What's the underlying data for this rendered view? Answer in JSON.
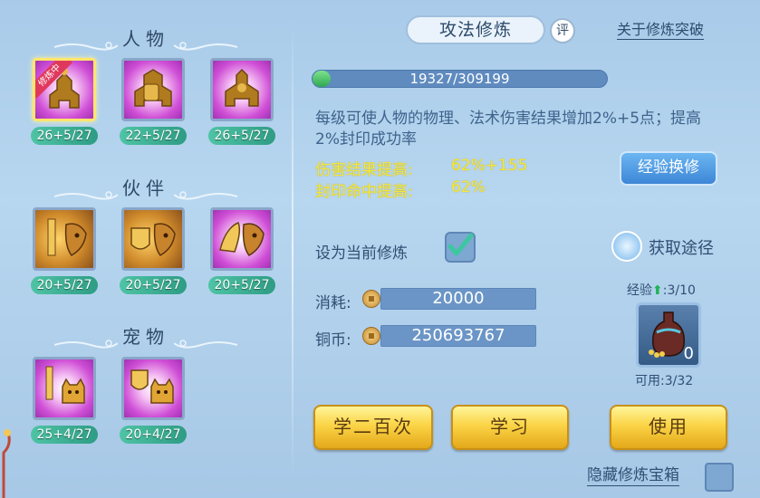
{
  "left": {
    "sections": [
      {
        "title": "人物",
        "skills": [
          {
            "level": "26+5/27",
            "icon": "character-attack-skill-icon",
            "badge": "修炼中",
            "selected": true
          },
          {
            "level": "22+5/27",
            "icon": "character-defense-skill-icon"
          },
          {
            "level": "26+5/27",
            "icon": "character-resist-skill-icon"
          }
        ]
      },
      {
        "title": "伙伴",
        "skills": [
          {
            "level": "20+5/27",
            "icon": "partner-attack-skill-icon"
          },
          {
            "level": "20+5/27",
            "icon": "partner-defense-skill-icon"
          },
          {
            "level": "20+5/27",
            "icon": "partner-resist-skill-icon"
          }
        ]
      },
      {
        "title": "宠物",
        "skills": [
          {
            "level": "25+4/27",
            "icon": "pet-attack-skill-icon"
          },
          {
            "level": "20+4/27",
            "icon": "pet-defense-skill-icon"
          }
        ]
      }
    ]
  },
  "right": {
    "title": "攻法修炼",
    "eval_badge": "评",
    "about_link": "关于修炼突破",
    "progress": {
      "text": "19327/309199",
      "fraction": 0.0625
    },
    "description": "每级可使人物的物理、法术伤害结果增加2%+5点；提高2%封印成功率",
    "stats": [
      {
        "label": "伤害结果提高:",
        "value": "62%+155"
      },
      {
        "label": "封印命中提高:",
        "value": "62%"
      }
    ],
    "exchange_button": "经验换修",
    "set_current_label": "设为当前修炼",
    "set_current_checked": true,
    "get_path_label": "获取途径",
    "cost_label": "消耗:",
    "cost_value": "20000",
    "coins_label": "铜币:",
    "coins_value": "250693767",
    "exp_label_prefix": "经验",
    "exp_label_value": ":3/10",
    "item_count": "0",
    "usable_label": "可用:3/32",
    "buttons": {
      "learn200": "学二百次",
      "learn": "学习",
      "use": "使用"
    },
    "hide_label": "隐藏修炼宝箱"
  },
  "colors": {
    "accent_gold": "#fbd446",
    "stat_yellow": "#f5e83a",
    "level_green": "#2e9c84"
  }
}
